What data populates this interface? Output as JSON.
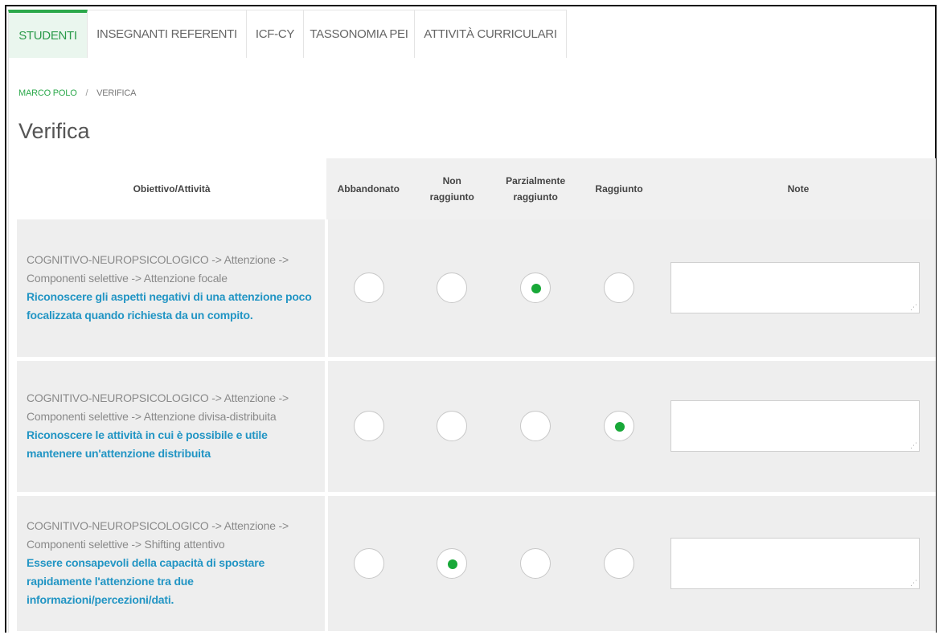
{
  "tabs": [
    {
      "label": "STUDENTI",
      "active": true
    },
    {
      "label": "INSEGNANTI REFERENTI",
      "active": false
    },
    {
      "label": "ICF-CY",
      "active": false
    },
    {
      "label": "TASSONOMIA PEI",
      "active": false
    },
    {
      "label": "ATTIVITÀ CURRICULARI",
      "active": false
    }
  ],
  "breadcrumb": {
    "link": "MARCO POLO",
    "separator": "/",
    "current": "VERIFICA"
  },
  "page_title": "Verifica",
  "table": {
    "headers": {
      "objective": "Obiettivo/Attività",
      "abandoned": "Abbandonato",
      "not_reached_1": "Non",
      "not_reached_2": "raggiunto",
      "partial_1": "Parzialmente",
      "partial_2": "raggiunto",
      "reached": "Raggiunto",
      "notes": "Note"
    },
    "rows": [
      {
        "path": "COGNITIVO-NEUROPSICOLOGICO -> Attenzione -> Componenti selettive -> Attenzione focale",
        "goal": "Riconoscere gli aspetti negativi di una attenzione poco focalizzata quando richiesta da un compito.",
        "selected": "Parzialmente raggiunto",
        "note": ""
      },
      {
        "path": "COGNITIVO-NEUROPSICOLOGICO -> Attenzione -> Componenti selettive -> Attenzione divisa-distribuita",
        "goal": "Riconoscere le attività in cui è possibile e utile mantenere un'attenzione distribuita",
        "selected": "Raggiunto",
        "note": ""
      },
      {
        "path": "COGNITIVO-NEUROPSICOLOGICO -> Attenzione -> Componenti selettive -> Shifting attentivo",
        "goal": "Essere consapevoli della capacità di spostare rapidamente l'attenzione tra due informazioni/percezioni/dati.",
        "selected": "Non raggiunto",
        "note": ""
      }
    ]
  },
  "colors": {
    "accent_green": "#2aa84a",
    "radio_selected": "#18a838",
    "goal_blue": "#2295c4",
    "cell_bg": "#eeeeee"
  }
}
